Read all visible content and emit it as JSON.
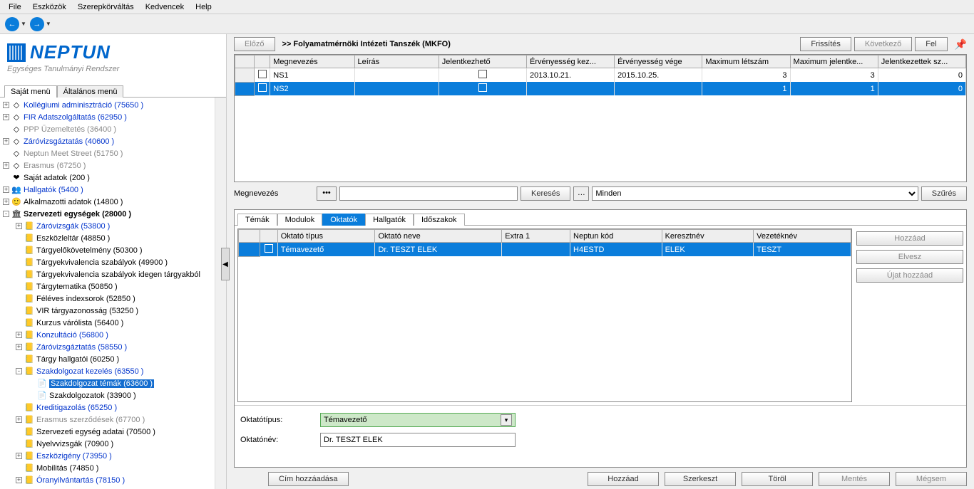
{
  "menubar": [
    "File",
    "Eszközök",
    "Szerepkörváltás",
    "Kedvencek",
    "Help"
  ],
  "logo": {
    "title": "NEPTUN",
    "subtitle": "Egységes Tanulmányi Rendszer"
  },
  "sidebar_tabs": [
    {
      "label": "Saját menü",
      "active": true
    },
    {
      "label": "Általános menü",
      "active": false
    }
  ],
  "tree": [
    {
      "depth": 0,
      "exp": "+",
      "icon": "◇",
      "label": "Kollégiumi adminisztráció (75650  )",
      "style": "link"
    },
    {
      "depth": 0,
      "exp": "+",
      "icon": "◇",
      "label": "FIR Adatszolgáltatás (62950  )",
      "style": "link"
    },
    {
      "depth": 0,
      "exp": " ",
      "icon": "◇",
      "label": "PPP Üzemeltetés (36400  )",
      "style": "gray"
    },
    {
      "depth": 0,
      "exp": "+",
      "icon": "◇",
      "label": "Záróvizsgáztatás (40600  )",
      "style": "link"
    },
    {
      "depth": 0,
      "exp": " ",
      "icon": "◇",
      "label": "Neptun Meet Street (51750  )",
      "style": "gray"
    },
    {
      "depth": 0,
      "exp": "+",
      "icon": "◇",
      "label": "Erasmus (67250  )",
      "style": "gray"
    },
    {
      "depth": 0,
      "exp": " ",
      "icon": "❤",
      "label": "Saját adatok (200  )",
      "style": "black"
    },
    {
      "depth": 0,
      "exp": "+",
      "icon": "👥",
      "label": "Hallgatók (5400  )",
      "style": "link"
    },
    {
      "depth": 0,
      "exp": "+",
      "icon": "🙂",
      "label": "Alkalmazotti adatok (14800  )",
      "style": "black"
    },
    {
      "depth": 0,
      "exp": "-",
      "icon": "🏛",
      "label": "Szervezeti egységek (28000  )",
      "style": "boldblack"
    },
    {
      "depth": 1,
      "exp": "+",
      "icon": "📒",
      "label": "Záróvizsgák (53800  )",
      "style": "link"
    },
    {
      "depth": 1,
      "exp": " ",
      "icon": "📒",
      "label": "Eszközleltár (48850  )",
      "style": "black"
    },
    {
      "depth": 1,
      "exp": " ",
      "icon": "📒",
      "label": "Tárgyelőkövetelmény (50300  )",
      "style": "black"
    },
    {
      "depth": 1,
      "exp": " ",
      "icon": "📒",
      "label": "Tárgyekvivalencia szabályok (49900  )",
      "style": "black"
    },
    {
      "depth": 1,
      "exp": " ",
      "icon": "📒",
      "label": "Tárgyekvivalencia szabályok idegen tárgyakból",
      "style": "black"
    },
    {
      "depth": 1,
      "exp": " ",
      "icon": "📒",
      "label": "Tárgytematika (50850  )",
      "style": "black"
    },
    {
      "depth": 1,
      "exp": " ",
      "icon": "📒",
      "label": "Féléves indexsorok (52850  )",
      "style": "black"
    },
    {
      "depth": 1,
      "exp": " ",
      "icon": "📒",
      "label": "VIR tárgyazonosság (53250  )",
      "style": "black"
    },
    {
      "depth": 1,
      "exp": " ",
      "icon": "📒",
      "label": "Kurzus várólista (56400  )",
      "style": "black"
    },
    {
      "depth": 1,
      "exp": "+",
      "icon": "📒",
      "label": "Konzultáció (56800  )",
      "style": "link"
    },
    {
      "depth": 1,
      "exp": "+",
      "icon": "📒",
      "label": "Záróvizsgáztatás (58550  )",
      "style": "link"
    },
    {
      "depth": 1,
      "exp": " ",
      "icon": "📒",
      "label": "Tárgy hallgatói (60250  )",
      "style": "black"
    },
    {
      "depth": 1,
      "exp": "-",
      "icon": "📒",
      "label": "Szakdolgozat kezelés (63550  )",
      "style": "link"
    },
    {
      "depth": 2,
      "exp": " ",
      "icon": "📄",
      "label": "Szakdolgozat témák (63600  )",
      "style": "selected"
    },
    {
      "depth": 2,
      "exp": " ",
      "icon": "📄",
      "label": "Szakdolgozatok (33900  )",
      "style": "black"
    },
    {
      "depth": 1,
      "exp": " ",
      "icon": "📒",
      "label": "Kreditigazolás (65250  )",
      "style": "link"
    },
    {
      "depth": 1,
      "exp": "+",
      "icon": "📒",
      "label": "Erasmus szerződések (67700  )",
      "style": "gray"
    },
    {
      "depth": 1,
      "exp": " ",
      "icon": "📒",
      "label": "Szervezeti egység adatai (70500  )",
      "style": "black"
    },
    {
      "depth": 1,
      "exp": " ",
      "icon": "📒",
      "label": "Nyelvvizsgák (70900  )",
      "style": "black"
    },
    {
      "depth": 1,
      "exp": "+",
      "icon": "📒",
      "label": "Eszközigény (73950  )",
      "style": "link"
    },
    {
      "depth": 1,
      "exp": " ",
      "icon": "📒",
      "label": "Mobilitás (74850  )",
      "style": "black"
    },
    {
      "depth": 1,
      "exp": "+",
      "icon": "📒",
      "label": "Óranyilvántartás (78150  )",
      "style": "link"
    }
  ],
  "toolbar": {
    "prev": "Előző",
    "breadcrumb": ">>  Folyamatmérnöki Intézeti Tanszék (MKFO)",
    "refresh": "Frissítés",
    "next": "Következő",
    "up": "Fel"
  },
  "grid1": {
    "headers": [
      "Megnevezés",
      "Leírás",
      "Jelentkezhető",
      "Érvényesség kez...",
      "Érvényesség vége",
      "Maximum létszám",
      "Maximum jelentke...",
      "Jelentkezettek sz..."
    ],
    "rows": [
      {
        "sel": false,
        "cells": [
          "NS1",
          "",
          "cb",
          "2013.10.21.",
          "2015.10.25.",
          "3",
          "3",
          "0"
        ]
      },
      {
        "sel": true,
        "cells": [
          "NS2",
          "",
          "cb",
          "",
          "",
          "1",
          "1",
          "0"
        ]
      }
    ]
  },
  "filter": {
    "label": "Megnevezés",
    "search_value": "",
    "search_btn": "Keresés",
    "all_option": "Minden",
    "filter_btn": "Szűrés"
  },
  "subtabs": [
    {
      "label": "Témák",
      "active": false
    },
    {
      "label": "Modulok",
      "active": false
    },
    {
      "label": "Oktatók",
      "active": true
    },
    {
      "label": "Hallgatók",
      "active": false
    },
    {
      "label": "Időszakok",
      "active": false
    }
  ],
  "grid2": {
    "headers": [
      "Oktató típus",
      "Oktató neve",
      "Extra 1",
      "Neptun kód",
      "Keresztnév",
      "Vezetéknév"
    ],
    "rows": [
      {
        "sel": true,
        "cells": [
          "Témavezető",
          "Dr. TESZT ELEK",
          "",
          "H4ESTD",
          "ELEK",
          "TESZT"
        ]
      }
    ]
  },
  "sidebtns": {
    "add": "Hozzáad",
    "remove": "Elvesz",
    "addnew": "Újat hozzáad"
  },
  "form": {
    "type_label": "Oktatótípus:",
    "type_value": "Témavezető",
    "name_label": "Oktatónév:",
    "name_value": "Dr. TESZT ELEK"
  },
  "bottom": {
    "addtitle": "Cím hozzáadása",
    "add": "Hozzáad",
    "edit": "Szerkeszt",
    "delete": "Töröl",
    "save": "Mentés",
    "cancel": "Mégsem"
  }
}
